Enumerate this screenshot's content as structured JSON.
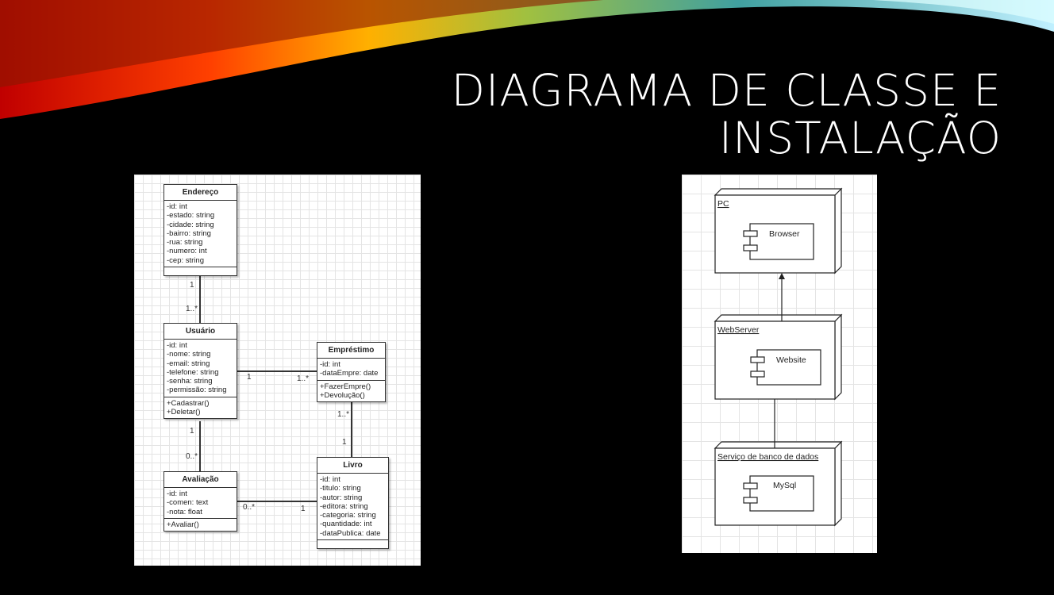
{
  "slide_title": {
    "line1": "DIAGRAMA DE CLASSE E",
    "line2": "INSTALAÇÃO"
  },
  "class_diagram": {
    "classes": [
      {
        "id": "endereco",
        "name": "Endereço",
        "attributes": [
          "-id: int",
          "-estado: string",
          "-cidade: string",
          "-bairro: string",
          "-rua: string",
          "-numero: int",
          "-cep: string"
        ],
        "methods": []
      },
      {
        "id": "usuario",
        "name": "Usuário",
        "attributes": [
          "-id: int",
          "-nome: string",
          "-email: string",
          "-telefone: string",
          "-senha: string",
          "-permissão: string"
        ],
        "methods": [
          "+Cadastrar()",
          "+Deletar()"
        ]
      },
      {
        "id": "emprestimo",
        "name": "Empréstimo",
        "attributes": [
          "-id: int",
          "-dataEmpre: date"
        ],
        "methods": [
          "+FazerEmpre()",
          "+Devolução()"
        ]
      },
      {
        "id": "avaliacao",
        "name": "Avaliação",
        "attributes": [
          "-id: int",
          "-comen: text",
          "-nota: float"
        ],
        "methods": [
          "+Avaliar()"
        ]
      },
      {
        "id": "livro",
        "name": "Livro",
        "attributes": [
          "-id: int",
          "-titulo: string",
          "-autor: string",
          "-editora: string",
          "-categoria: string",
          "-quantidade: int",
          "-dataPublica: date"
        ],
        "methods": []
      }
    ],
    "associations": [
      {
        "from": "endereco",
        "to": "usuario",
        "from_mult": "1",
        "to_mult": "1..*"
      },
      {
        "from": "usuario",
        "to": "emprestimo",
        "from_mult": "1",
        "to_mult": "1..*"
      },
      {
        "from": "emprestimo",
        "to": "livro",
        "from_mult": "1..*",
        "to_mult": "1"
      },
      {
        "from": "usuario",
        "to": "avaliacao",
        "from_mult": "1",
        "to_mult": "0..*"
      },
      {
        "from": "avaliacao",
        "to": "livro",
        "from_mult": "0..*",
        "to_mult": "1"
      }
    ]
  },
  "deployment_diagram": {
    "nodes": [
      {
        "name": "PC",
        "component": "Browser"
      },
      {
        "name": "WebServer",
        "component": "Website"
      },
      {
        "name": "Serviço de banco de dados",
        "component": "MySql"
      }
    ]
  }
}
